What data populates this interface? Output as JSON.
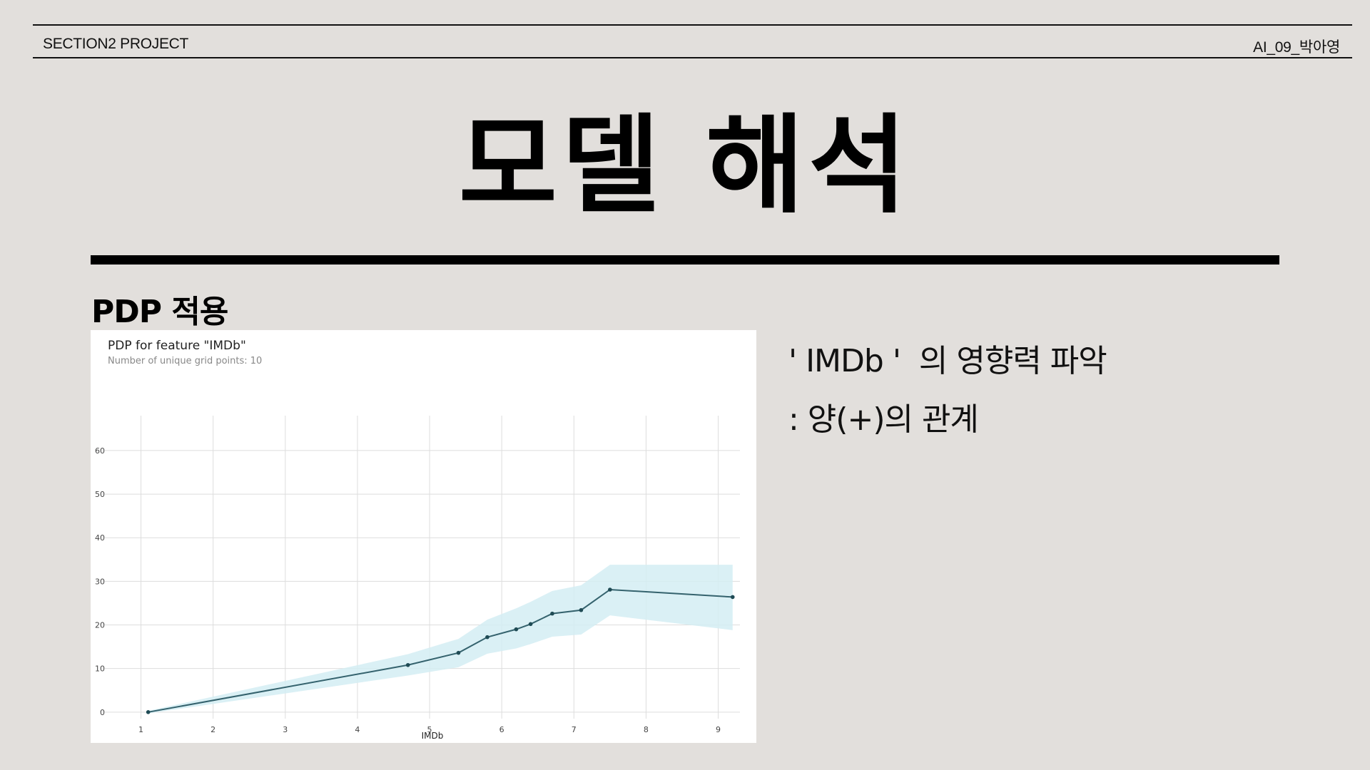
{
  "header": {
    "left_label": "SECTION2 PROJECT",
    "right_label": "AI_09_박아영"
  },
  "title": "모델 해석",
  "section_heading": "PDP 적용",
  "description": {
    "line1": "' IMDb '  의 영향력 파악",
    "line2": ": 양(+)의 관계"
  },
  "colors": {
    "background": "#e2dfdc",
    "line": "#34626d",
    "band": "#d3edf3"
  },
  "chart_data": {
    "type": "line",
    "title": "PDP for feature \"IMDb\"",
    "subtitle": "Number of unique grid points: 10",
    "xlabel": "IMDb",
    "ylabel": "",
    "xlim": [
      0.5,
      9.4
    ],
    "ylim": [
      -1.5,
      68
    ],
    "xticks": [
      1,
      2,
      3,
      4,
      5,
      6,
      7,
      8,
      9
    ],
    "yticks": [
      0,
      10,
      20,
      30,
      40,
      50,
      60
    ],
    "grid": true,
    "x": [
      1.1,
      4.7,
      5.4,
      5.8,
      6.2,
      6.4,
      6.7,
      7.1,
      7.5,
      9.2
    ],
    "y": [
      0,
      10.8,
      13.6,
      17.2,
      19,
      20.2,
      22.6,
      23.4,
      28.1,
      26.4
    ],
    "band_upper": [
      0.3,
      13.3,
      16.8,
      21.2,
      23.8,
      25.3,
      27.8,
      29.1,
      33.8,
      33.8
    ],
    "band_lower": [
      -0.3,
      8.4,
      10.3,
      13.4,
      14.6,
      15.6,
      17.3,
      17.8,
      22.2,
      18.8
    ]
  }
}
